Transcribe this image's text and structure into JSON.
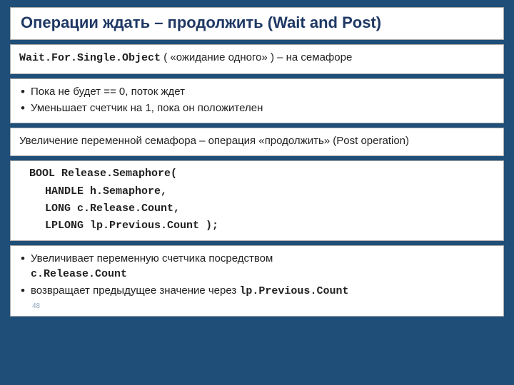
{
  "title": "Операции ждать – продолжить (Wait and Post)",
  "box1": {
    "func": "Wait.For.Single.Object",
    "desc": " ( «ожидание одного» ) – на семафоре"
  },
  "box2": {
    "b1": "Пока не будет == 0, поток ждет",
    "b2": "Уменьшает счетчик на 1, пока он положителен"
  },
  "box3": {
    "text": "Увеличение переменной семафора – операция «продолжить» (Post operation)"
  },
  "box4": {
    "l1": "BOOL Release.Semaphore(",
    "l2": "HANDLE h.Semaphore,",
    "l3": "LONG c.Release.Count,",
    "l4": "LPLONG lp.Previous.Count );"
  },
  "box5": {
    "b1a": "Увеличивает переменную счетчика посредством ",
    "b1b": "c.Release.Count",
    "b2a": "возвращает предыдущее значение через ",
    "b2b": "lp.Previous.Count",
    "pagenum": "48"
  }
}
